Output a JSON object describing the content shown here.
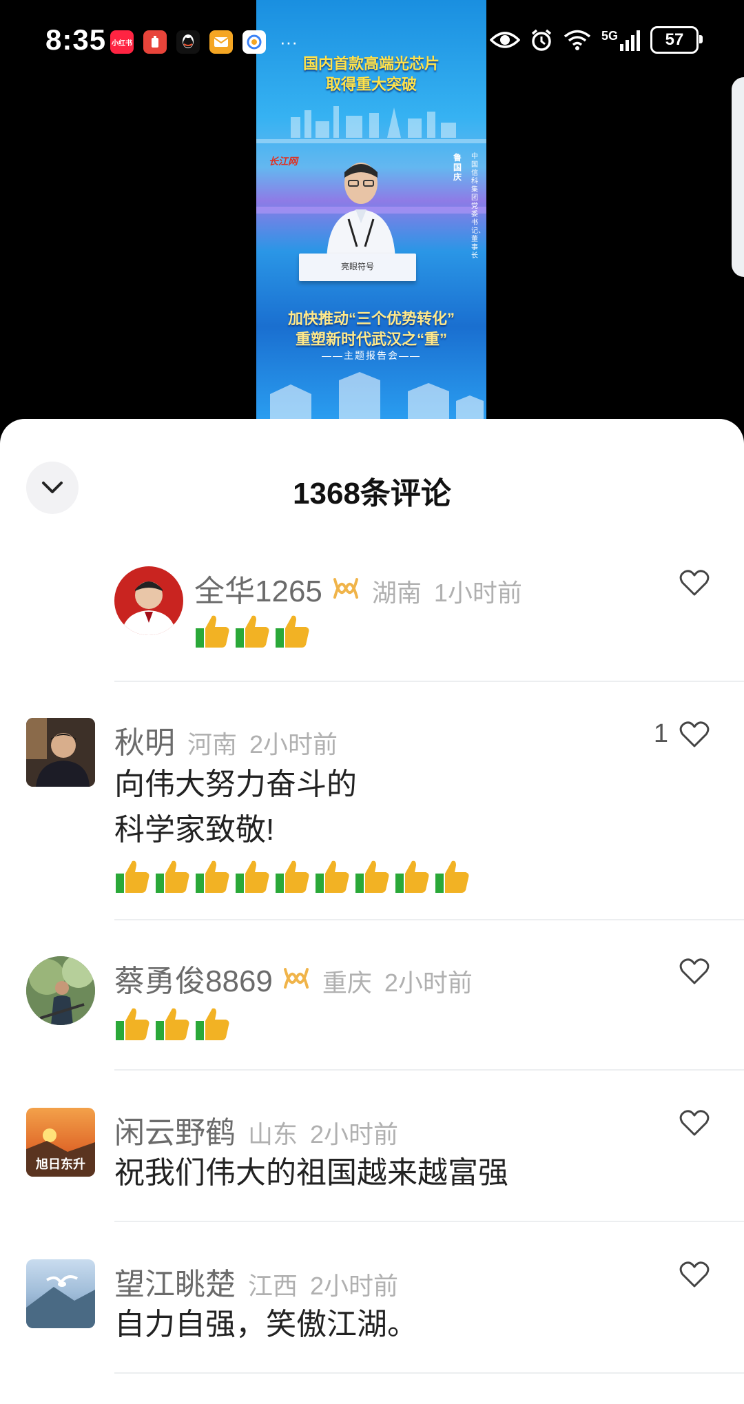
{
  "status_bar": {
    "time": "8:35",
    "app_icons": [
      {
        "name": "xiaohongshu-icon",
        "label": "小红书",
        "color": "#ff2442"
      },
      {
        "name": "app-red-icon",
        "label": "",
        "color": "#e8443a"
      },
      {
        "name": "qq-icon",
        "label": "",
        "color": "#111111"
      },
      {
        "name": "mail-icon",
        "label": "",
        "color": "#f5a623"
      },
      {
        "name": "browser-icon",
        "label": "",
        "color": "#3b82f6"
      }
    ],
    "more": "···",
    "network": "5G",
    "battery": "57"
  },
  "video": {
    "headline_line1": "国内首款高端光芯片",
    "headline_line2": "取得重大突破",
    "station_logo": "长江网",
    "speaker_name": "鲁国庆",
    "speaker_title": "中国信科集团党委书记、董事长",
    "podium_label": "亮眼符号",
    "subtitle_line1": "加快推动“三个优势转化”",
    "subtitle_line2": "重塑新时代武汉之“重”",
    "subtitle_line3": "——主题报告会——"
  },
  "sheet": {
    "title": "1368条评论"
  },
  "comments": [
    {
      "name": "全华1265",
      "badge": true,
      "region": "湖南",
      "time": "1小时前",
      "text": "",
      "emoji_count": 3,
      "likes": ""
    },
    {
      "name": "秋明",
      "badge": false,
      "region": "河南",
      "time": "2小时前",
      "text": "向伟大努力奋斗的\n科学家致敬!",
      "emoji_count": 9,
      "likes": "1"
    },
    {
      "name": "蔡勇俊8869",
      "badge": true,
      "region": "重庆",
      "time": "2小时前",
      "text": "",
      "emoji_count": 3,
      "likes": ""
    },
    {
      "name": "闲云野鹤",
      "badge": false,
      "region": "山东",
      "time": "2小时前",
      "text": "祝我们伟大的祖国越来越富强",
      "emoji_count": 0,
      "likes": "",
      "avatar_caption": "旭日东升"
    },
    {
      "name": "望江眺楚",
      "badge": false,
      "region": "江西",
      "time": "2小时前",
      "text": "自力自强，笑傲江湖。",
      "emoji_count": 0,
      "likes": ""
    }
  ],
  "colors": {
    "sheet_bg": "#ffffff",
    "name_gray": "#6b6b6b",
    "meta_gray": "#b0b0b0",
    "badge_gold": "#f0b44a"
  }
}
